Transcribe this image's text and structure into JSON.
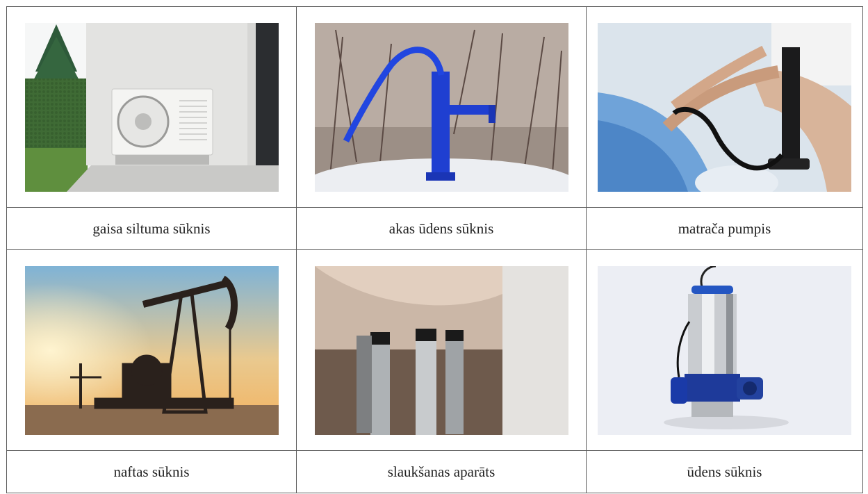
{
  "rows": [
    {
      "cells": [
        {
          "caption": "gaisa siltuma sūknis",
          "image": "air-source-heat-pump-photo"
        },
        {
          "caption": "akas ūdens sūknis",
          "image": "hand-water-well-pump-photo"
        },
        {
          "caption": "matrača pumpis",
          "image": "mattress-air-pump-photo"
        }
      ]
    },
    {
      "cells": [
        {
          "caption": "naftas sūknis",
          "image": "oil-pumpjack-photo"
        },
        {
          "caption": "slaukšanas aparāts",
          "image": "milking-machine-photo"
        },
        {
          "caption": "ūdens sūknis",
          "image": "submersible-water-pump-photo"
        }
      ]
    }
  ]
}
